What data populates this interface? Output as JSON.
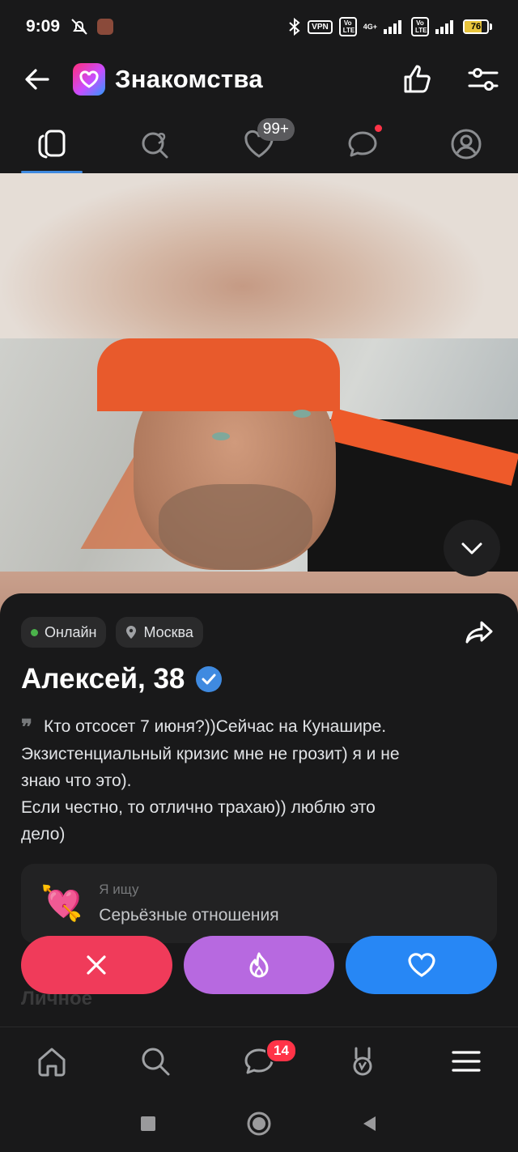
{
  "status_bar": {
    "time": "9:09",
    "vpn": "VPN",
    "lte1": "Vo LTE",
    "net": "4G+",
    "lte2": "Vo LTE",
    "battery": "76",
    "battery_level": 0.76
  },
  "header": {
    "title": "Знакомства",
    "back_icon": "arrow-left-icon",
    "like_icon": "thumbs-up-icon",
    "filter_icon": "sliders-icon"
  },
  "tabs": [
    {
      "id": "cards",
      "icon": "cards-icon",
      "active": true
    },
    {
      "id": "search",
      "icon": "heart-search-icon"
    },
    {
      "id": "likes",
      "icon": "heart-icon",
      "badge": "99+"
    },
    {
      "id": "chats",
      "icon": "chat-icon",
      "dot": true
    },
    {
      "id": "profile",
      "icon": "user-icon"
    }
  ],
  "profile": {
    "status": "Онлайн",
    "city": "Москва",
    "name": "Алексей, 38",
    "bio_lines": [
      "Кто отсосет 7 июня?))Сейчас на Кунашире.",
      "Экзистенциальный кризис мне не грозит) я и не",
      "знаю что это).",
      "Если честно, то отлично трахаю)) люблю это",
      "дело)"
    ],
    "looking_label": "Я ищу",
    "looking_value": "Серьёзные отношения",
    "looking_emoji": "💘"
  },
  "section_hint": "Личное",
  "bottom_nav": {
    "chat_badge": "14"
  },
  "colors": {
    "accent": "#3f8ae0",
    "dislike": "#f03b5a",
    "super": "#b769e0",
    "like": "#2787f5",
    "badge": "#ff3347"
  }
}
